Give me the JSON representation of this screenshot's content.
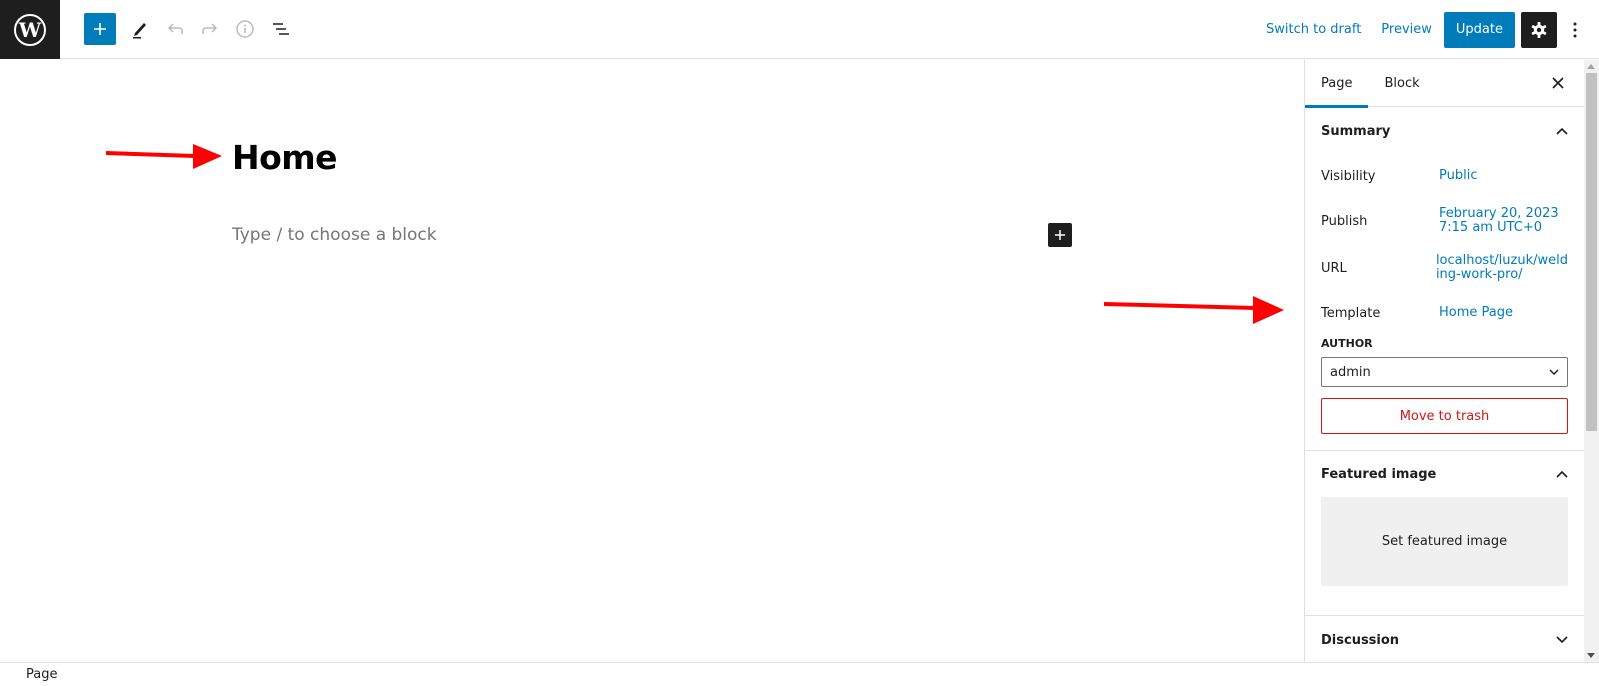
{
  "toolbar": {
    "logo": "wordpress-logo",
    "icons": [
      "plus-icon",
      "pencil-icon",
      "undo-icon",
      "redo-icon",
      "info-icon",
      "list-view-icon"
    ],
    "switch_to_draft": "Switch to draft",
    "preview": "Preview",
    "update": "Update"
  },
  "editor": {
    "title": "Home",
    "placeholder": "Type / to choose a block"
  },
  "sidebar": {
    "tabs": [
      {
        "label": "Page",
        "active": true
      },
      {
        "label": "Block",
        "active": false
      }
    ],
    "summary": {
      "heading": "Summary",
      "rows": [
        {
          "label": "Visibility",
          "value": "Public"
        },
        {
          "label": "Publish",
          "value_line1": "February 20, 2023",
          "value_line2": "7:15 am UTC+0"
        },
        {
          "label": "URL",
          "value_line1": "localhost/luzuk/weld",
          "value_line2": "ing-work-pro/"
        },
        {
          "label": "Template",
          "value": "Home Page"
        }
      ],
      "author_label": "AUTHOR",
      "author_value": "admin",
      "trash_label": "Move to trash"
    },
    "featured_image": {
      "heading": "Featured image",
      "button": "Set featured image"
    },
    "discussion": {
      "heading": "Discussion"
    }
  },
  "footer": {
    "breadcrumb": "Page"
  },
  "colors": {
    "accent": "#007cba",
    "dark": "#1e1e1e",
    "danger": "#cc1818",
    "annotation_arrow": "#ff0000"
  }
}
